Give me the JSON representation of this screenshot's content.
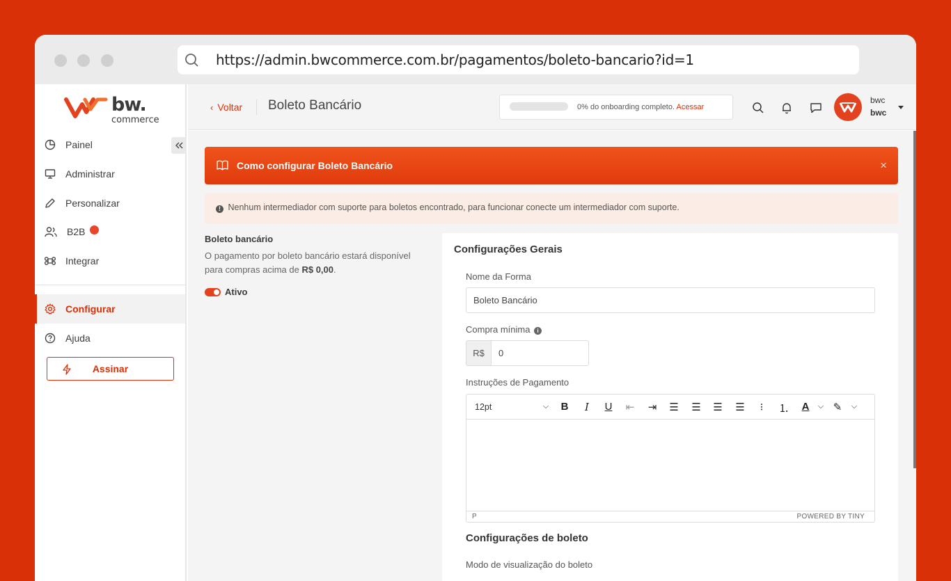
{
  "browser": {
    "url": "https://admin.bwcommerce.com.br/pagamentos/boleto-bancario?id=1"
  },
  "logo": {
    "text": "bw.",
    "sub": "commerce"
  },
  "sidebar": {
    "items": [
      {
        "label": "Painel",
        "icon": "pie-chart-icon"
      },
      {
        "label": "Administrar",
        "icon": "monitor-icon"
      },
      {
        "label": "Personalizar",
        "icon": "pencil-icon"
      },
      {
        "label": "B2B",
        "icon": "users-icon"
      },
      {
        "label": "Integrar",
        "icon": "command-icon"
      },
      {
        "label": "Configurar",
        "icon": "gear-icon",
        "active": true
      },
      {
        "label": "Ajuda",
        "icon": "help-circle-icon"
      }
    ],
    "subscribe_label": "Assinar"
  },
  "topbar": {
    "back_label": "Voltar",
    "title": "Boleto Bancário",
    "onboarding_text": "0% do onboarding completo.",
    "onboarding_link": "Acessar",
    "onboarding_progress": 0,
    "user_name": "bwc",
    "user_company": "bwc"
  },
  "banner": {
    "text": "Como configurar Boleto Bancário",
    "close": "×"
  },
  "alert": {
    "text": "Nenhum intermediador com suporte para boletos encontrado, para funcionar conecte um intermediador com suporte."
  },
  "method": {
    "title": "Boleto bancário",
    "description": "O pagamento por boleto bancário estará disponível para compras acima de",
    "min_value": "R$ 0,00",
    "status_label": "Ativo",
    "active": true
  },
  "form": {
    "section_title": "Configurações Gerais",
    "name_label": "Nome da Forma",
    "name_value": "Boleto Bancário",
    "min_label": "Compra mínima",
    "currency": "R$",
    "min_value": "0",
    "instructions_label": "Instruções de Pagamento",
    "editor": {
      "font_size": "12pt",
      "status_path": "P",
      "powered_by": "POWERED BY TINY"
    },
    "section2_title": "Configurações de boleto",
    "view_mode_label": "Modo de visualização do boleto"
  },
  "colors": {
    "brand": "#d93008",
    "accent": "#e2421f"
  }
}
